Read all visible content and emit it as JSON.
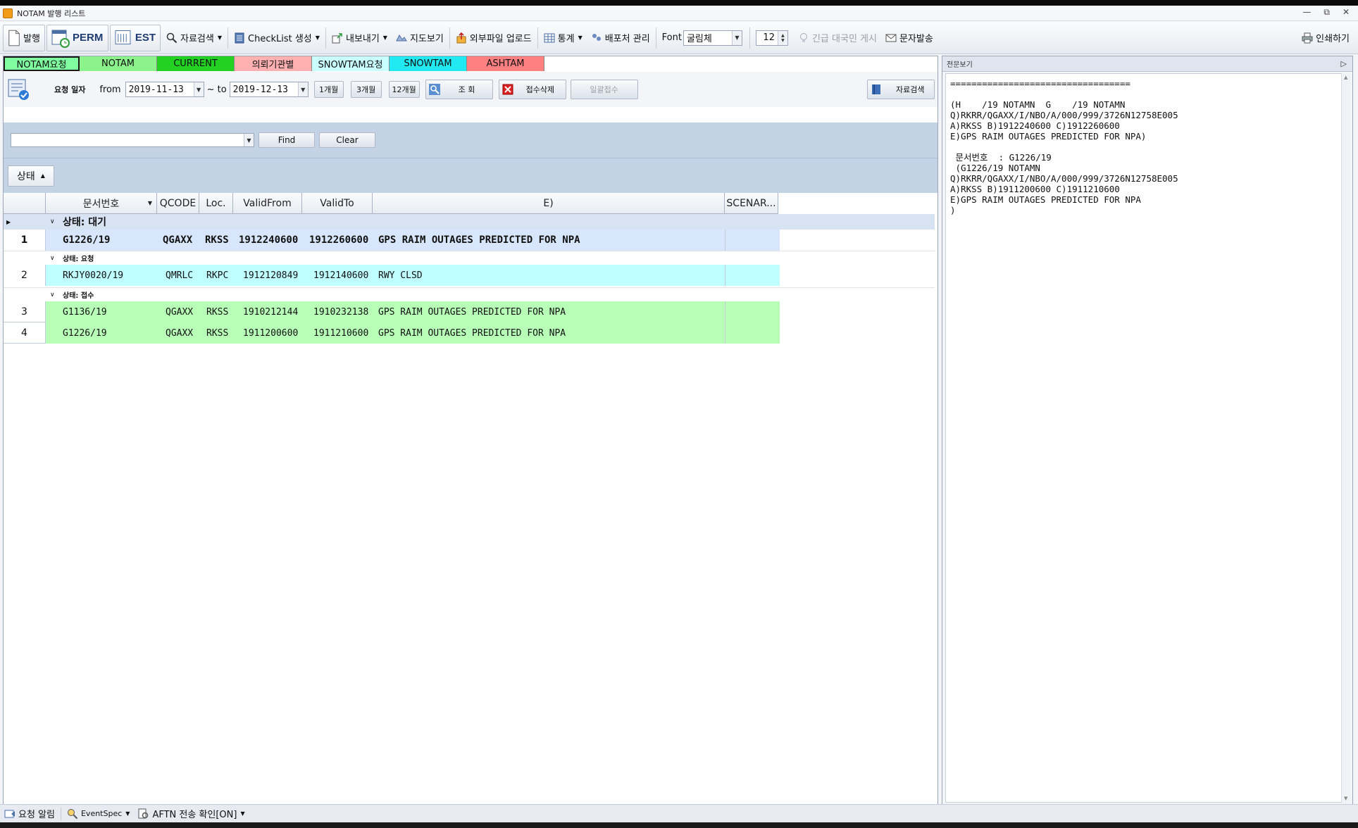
{
  "window": {
    "title": "NOTAM 발행 리스트"
  },
  "toolbar": {
    "publish": "발행",
    "perm": "PERM",
    "est": "EST",
    "data_search": "자료검색",
    "checklist": "CheckList 생성",
    "export": "내보내기",
    "map_view": "지도보기",
    "upload": "외부파일 업로드",
    "stats": "통계",
    "dist_mgmt": "배포처 관리",
    "font_label": "Font",
    "font_value": "굴림체",
    "font_size": "12",
    "emergency": "긴급 대국민 게시",
    "sms": "문자발송",
    "print": "인쇄하기"
  },
  "tabs": [
    {
      "label": "NOTAM요청",
      "bg": "#7fffa0"
    },
    {
      "label": "NOTAM",
      "bg": "#8cf28c"
    },
    {
      "label": "CURRENT",
      "bg": "#22d122"
    },
    {
      "label": "의뢰기관별",
      "bg": "#ffb0b0"
    },
    {
      "label": "SNOWTAM요청",
      "bg": "#c9ffff"
    },
    {
      "label": "SNOWTAM",
      "bg": "#22e8f2"
    },
    {
      "label": "ASHTAM",
      "bg": "#ff8080"
    }
  ],
  "filter": {
    "request_date_label": "요청 일자",
    "from_label": "from",
    "from_value": "2019-11-13",
    "to_label": "~ to",
    "to_value": "2019-12-13",
    "btn_1m": "1개월",
    "btn_3m": "3개월",
    "btn_12m": "12개월",
    "search": "조 회",
    "delete_receipt": "접수삭제",
    "bulk_receipt": "일괄접수",
    "data_search": "자료검색"
  },
  "find": {
    "find": "Find",
    "clear": "Clear"
  },
  "group_by": {
    "label": "상태"
  },
  "columns": [
    "문서번호",
    "QCODE",
    "Loc.",
    "ValidFrom",
    "ValidTo",
    "E)",
    "SCENAR..."
  ],
  "groups": [
    {
      "label": "상태: 대기",
      "rows": [
        {
          "num": "1",
          "doc": "G1226/19",
          "qcode": "QGAXX",
          "loc": "RKSS",
          "from": "1912240600",
          "to": "1912260600",
          "e": "GPS RAIM OUTAGES PREDICTED FOR NPA",
          "scenario": ""
        }
      ]
    },
    {
      "label": "상태: 요청",
      "rows": [
        {
          "num": "2",
          "doc": "RKJY0020/19",
          "qcode": "QMRLC",
          "loc": "RKPC",
          "from": "1912120849",
          "to": "1912140600",
          "e": "RWY CLSD",
          "scenario": ""
        }
      ]
    },
    {
      "label": "상태: 접수",
      "rows": [
        {
          "num": "3",
          "doc": "G1136/19",
          "qcode": "QGAXX",
          "loc": "RKSS",
          "from": "1910212144",
          "to": "1910232138",
          "e": "GPS RAIM OUTAGES PREDICTED FOR NPA",
          "scenario": ""
        },
        {
          "num": "4",
          "doc": "G1226/19",
          "qcode": "QGAXX",
          "loc": "RKSS",
          "from": "1911200600",
          "to": "1911210600",
          "e": "GPS RAIM OUTAGES PREDICTED FOR NPA",
          "scenario": ""
        }
      ]
    }
  ],
  "colors": {
    "row_wait": "#d8e6fb",
    "row_request": "#bfffff",
    "row_received": "#b8ffb8",
    "header_band": "#c4d2e5"
  },
  "preview": {
    "title": "전문보기",
    "text": "==================================\n\n(H    /19 NOTAMN  G    /19 NOTAMN\nQ)RKRR/QGAXX/I/NBO/A/000/999/3726N12758E005\nA)RKSS B)1912240600 C)1912260600\nE)GPS RAIM OUTAGES PREDICTED FOR NPA)\n\n 문서번호  : G1226/19\n (G1226/19 NOTAMN\nQ)RKRR/QGAXX/I/NBO/A/000/999/3726N12758E005\nA)RKSS B)1911200600 C)1911210600\nE)GPS RAIM OUTAGES PREDICTED FOR NPA\n)"
  },
  "status": {
    "request_alert": "요청 알림",
    "event_spec": "EventSpec",
    "aftn": "AFTN 전송 확인[ON]"
  }
}
